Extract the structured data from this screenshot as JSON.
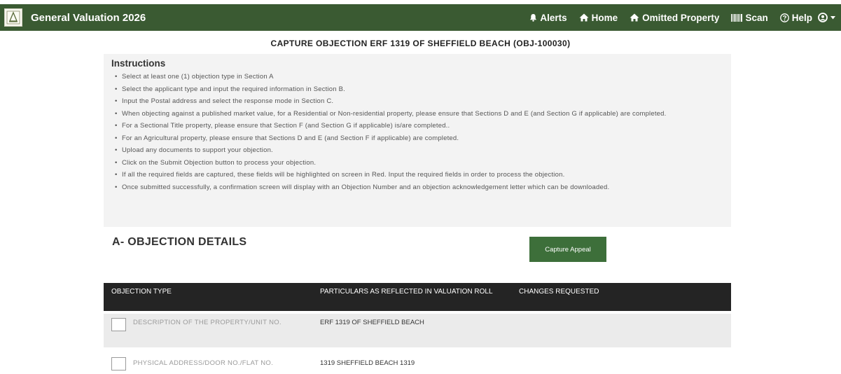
{
  "header": {
    "app_title": "General Valuation 2026",
    "nav": [
      {
        "label": "Alerts",
        "icon": "bell-icon"
      },
      {
        "label": "Home",
        "icon": "home-icon"
      },
      {
        "label": "Omitted Property",
        "icon": "home-icon"
      },
      {
        "label": "Scan",
        "icon": "barcode-icon"
      },
      {
        "label": "Help",
        "icon": "help-circle-icon"
      }
    ],
    "user_menu_icon": "user-icon"
  },
  "page_title": "CAPTURE OBJECTION ERF 1319 OF SHEFFIELD BEACH (OBJ-100030)",
  "instructions": {
    "heading": "Instructions",
    "items": [
      "Select at least one (1) objection type in Section A",
      "Select the applicant type and input the required information in Section B.",
      "Input the Postal address and select the response mode in Section C.",
      "When objecting against a published market value, for a Residential or Non-residential property, please ensure that Sections D and E (and Section G if applicable) are completed.",
      "For a Sectional Title property, please ensure that Section F (and Section G if applicable) is/are completed..",
      "For an Agricultural property, please ensure that Sections D and E (and Section F if applicable) are completed.",
      "Upload any documents to support your objection.",
      "Click on the Submit Objection button to process your objection.",
      "If all the required fields are captured, these fields will be highlighted on screen in Red. Input the required fields in order to process the objection.",
      "Once submitted successfully, a confirmation screen will display with an Objection Number and an objection acknowledgement letter which can be downloaded."
    ]
  },
  "section_a": {
    "title": "A- OBJECTION DETAILS",
    "capture_button": "Capture Appeal",
    "table": {
      "headers": [
        "OBJECTION TYPE",
        "PARTICULARS AS REFLECTED IN VALUATION ROLL",
        "CHANGES REQUESTED"
      ],
      "rows": [
        {
          "type": "DESCRIPTION OF THE PROPERTY/UNIT NO.",
          "particulars": "ERF 1319 OF SHEFFIELD BEACH"
        },
        {
          "type": "PHYSICAL ADDRESS/DOOR NO./FLAT NO.",
          "particulars": "1319 SHEFFIELD BEACH 1319"
        }
      ]
    }
  },
  "colors": {
    "header_bg": "#3a5a32",
    "button_bg": "#3d6f3a",
    "table_header_bg": "#242424",
    "instructions_bg": "#f3f3f3"
  }
}
